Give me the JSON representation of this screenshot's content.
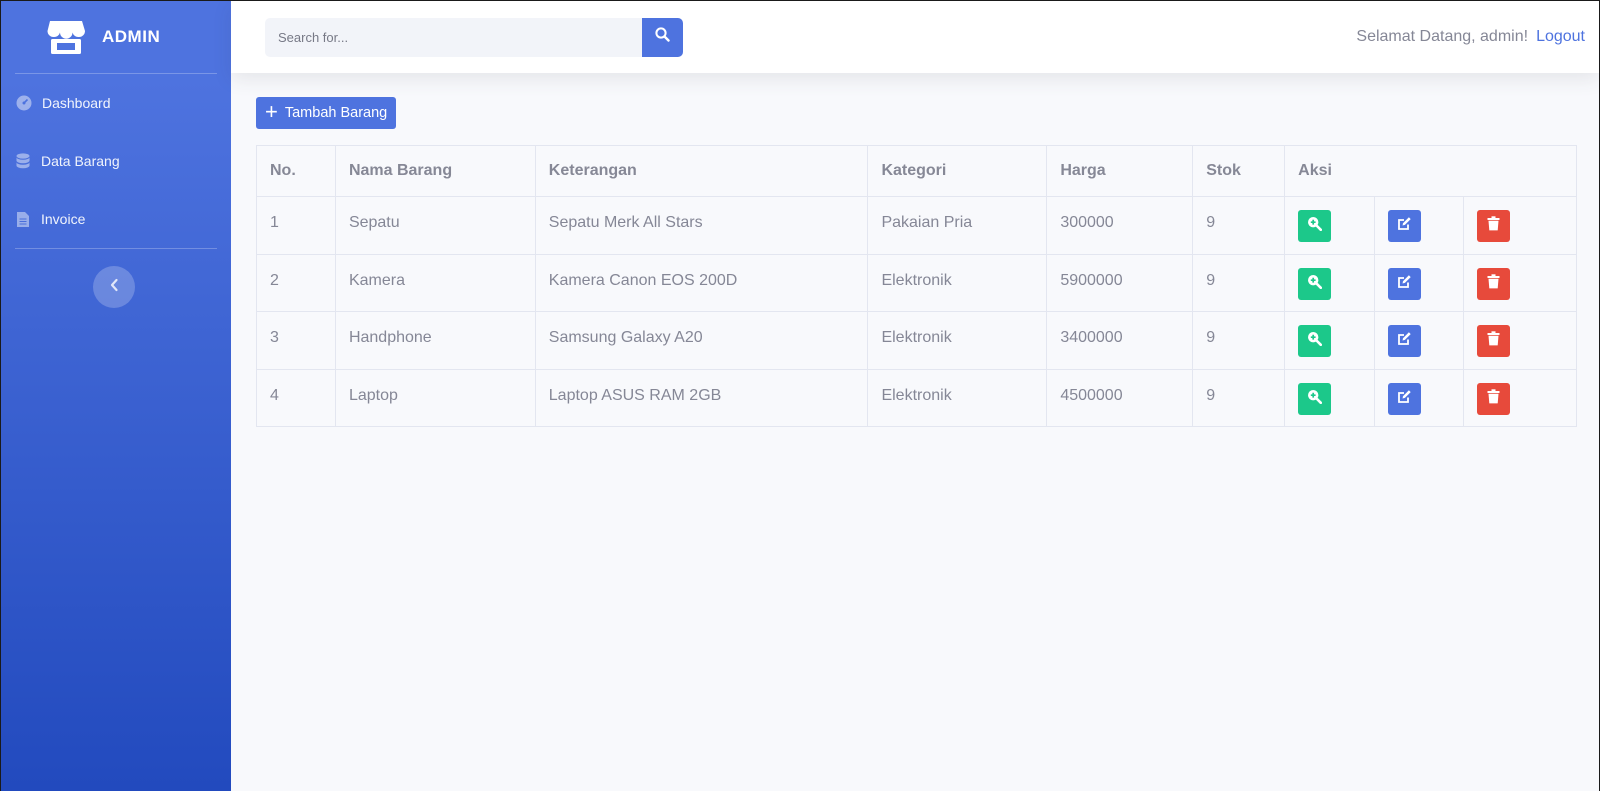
{
  "sidebar": {
    "brand": "ADMIN",
    "items": [
      {
        "label": "Dashboard",
        "icon": "dashboard-icon"
      },
      {
        "label": "Data Barang",
        "icon": "database-icon"
      },
      {
        "label": "Invoice",
        "icon": "file-icon"
      }
    ],
    "toggle_icon": "chevron-left-icon"
  },
  "topbar": {
    "search_placeholder": "Search for...",
    "welcome": "Selamat Datang, admin!",
    "logout": "Logout"
  },
  "main": {
    "add_button": "Tambah Barang",
    "table": {
      "headers": [
        "No.",
        "Nama Barang",
        "Keterangan",
        "Kategori",
        "Harga",
        "Stok",
        "Aksi"
      ],
      "rows": [
        [
          "1",
          "Sepatu",
          "Sepatu Merk All Stars",
          "Pakaian Pria",
          "300000",
          "9"
        ],
        [
          "2",
          "Kamera",
          "Kamera Canon EOS 200D",
          "Elektronik",
          "5900000",
          "9"
        ],
        [
          "3",
          "Handphone",
          "Samsung Galaxy A20",
          "Elektronik",
          "3400000",
          "9"
        ],
        [
          "4",
          "Laptop",
          "Laptop ASUS RAM 2GB",
          "Elektronik",
          "4500000",
          "9"
        ]
      ]
    }
  },
  "colors": {
    "primary": "#4e73df",
    "success": "#1cc88a",
    "danger": "#e74a3b",
    "text": "#858796"
  }
}
